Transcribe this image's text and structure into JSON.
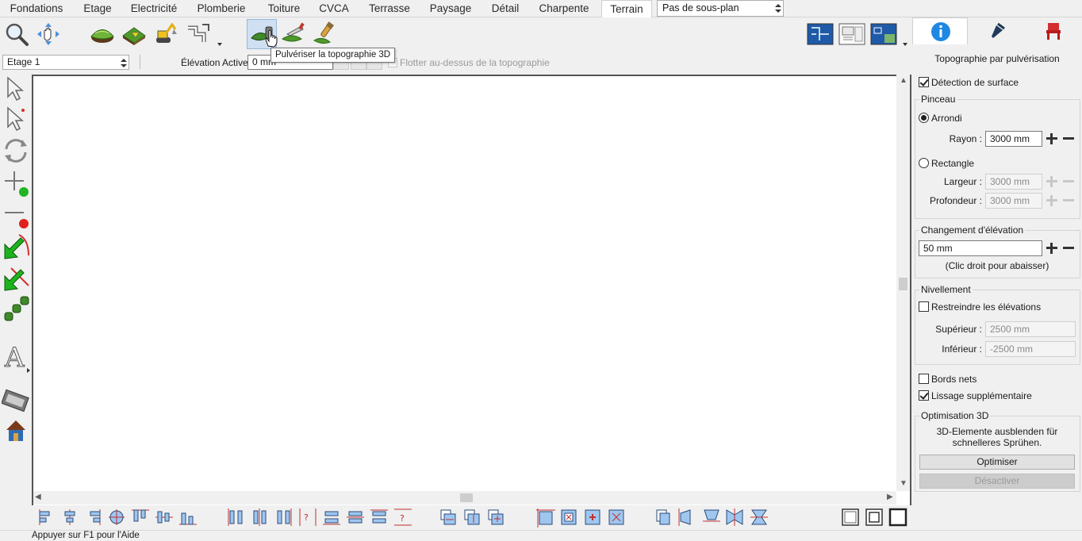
{
  "tabs": [
    "Fondations",
    "Etage",
    "Electricité",
    "Plomberie",
    "Toiture",
    "CVCA",
    "Terrasse",
    "Paysage",
    "Détail",
    "Charpente",
    "Terrain"
  ],
  "active_tab": "Terrain",
  "subplan_select": "Pas de sous-plan",
  "floor_select": "Etage 1",
  "elevation_label": "Élévation Active:",
  "elevation_value": "0 mm",
  "float_label": "Flotter au-dessus de la topographie",
  "tooltip": "Pulvériser la topographie 3D",
  "status": "Appuyer sur F1 pour l'Aide",
  "panel": {
    "title": "Topographie par pulvérisation",
    "surface_detection": "Détection de surface",
    "brush_group": "Pinceau",
    "round": "Arrondi",
    "radius_label": "Rayon :",
    "radius_value": "3000 mm",
    "rectangle": "Rectangle",
    "width_label": "Largeur :",
    "width_value": "3000 mm",
    "depth_label": "Profondeur :",
    "depth_value": "3000 mm",
    "elev_change_group": "Changement d'élévation",
    "elev_change_value": "50 mm",
    "elev_change_hint": "(Clic droit pour abaisser)",
    "leveling_group": "Nivellement",
    "restrict": "Restreindre les élévations",
    "upper_label": "Supérieur :",
    "upper_value": "2500 mm",
    "lower_label": "Inférieur :",
    "lower_value": "-2500 mm",
    "sharp_edges": "Bords nets",
    "extra_smoothing": "Lissage supplémentaire",
    "optim_group": "Optimisation 3D",
    "optim_msg_1": "3D-Elemente ausblenden für",
    "optim_msg_2": "schnelleres Sprühen.",
    "optimize_btn": "Optimiser",
    "disable_btn": "Désactiver"
  },
  "colors": {
    "accent": "#cfe0f2",
    "info_blue": "#1e88e5",
    "chair_red": "#d32f2f",
    "terrain_green": "#3f8a2a"
  }
}
